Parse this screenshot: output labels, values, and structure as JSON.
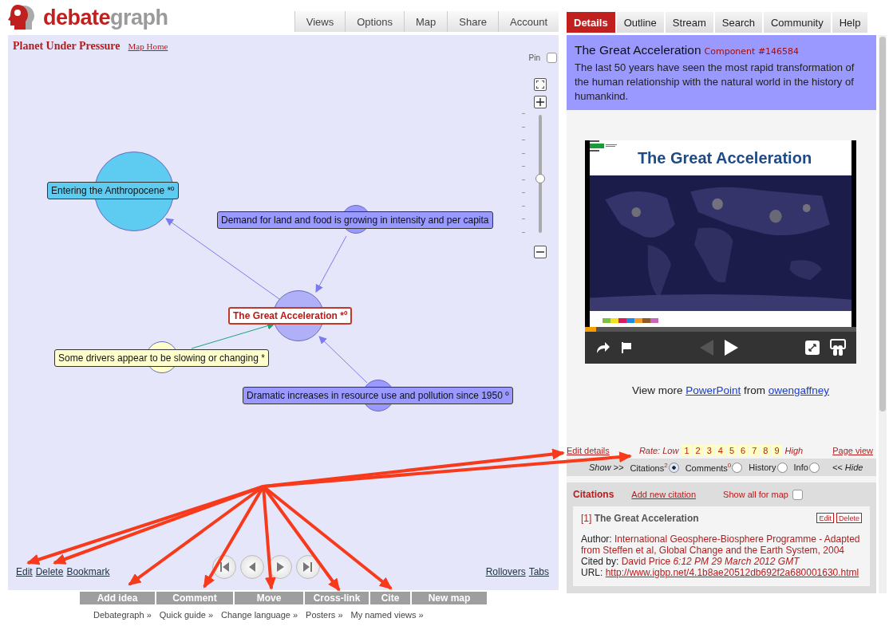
{
  "logo": {
    "parts": [
      "debate",
      "graph"
    ]
  },
  "top_menu": [
    "Views",
    "Options",
    "Map",
    "Share",
    "Account"
  ],
  "map": {
    "title": "Planet Under Pressure",
    "home_link": "Map Home",
    "pin": {
      "label": "Pin",
      "checked": false
    },
    "zoom": {
      "level": 0.45
    },
    "nodes": [
      {
        "label": "Entering the Anthropocene *º",
        "color": "#5ecbf0",
        "selected": false
      },
      {
        "label": "Demand for land and food is growing in intensity and per capita",
        "color": "#9999ff",
        "selected": false
      },
      {
        "label": "The Great Acceleration *º",
        "color": "#ffffff",
        "selected": true
      },
      {
        "label": "Some drivers appear to be slowing or changing *",
        "color": "#ffffcc",
        "selected": false
      },
      {
        "label": "Dramatic increases in resource use and pollution since 1950 º",
        "color": "#9999ff",
        "selected": false
      }
    ],
    "left_links": [
      "Edit",
      "Delete",
      "Bookmark"
    ],
    "right_links": [
      "Rollovers",
      "Tabs"
    ]
  },
  "actions": [
    "Add idea",
    "Comment",
    "Move",
    "Cross-link",
    "Cite",
    "New map"
  ],
  "footer_links": [
    "Debategraph »",
    "Quick guide »",
    "Change language »",
    "Posters »",
    "My named views »"
  ],
  "tabs": [
    {
      "label": "Details",
      "selected": true
    },
    {
      "label": "Outline",
      "selected": false
    },
    {
      "label": "Stream",
      "selected": false
    },
    {
      "label": "Search",
      "selected": false
    },
    {
      "label": "Community",
      "selected": false
    },
    {
      "label": "Help",
      "selected": false
    }
  ],
  "details": {
    "title": "The Great Acceleration",
    "component": "Component #146584",
    "text": "The last 50 years have seen the most rapid transformation of the human relationship with the natural world in the history of humankind."
  },
  "slide": {
    "title": "The Great Acceleration",
    "progress": {
      "level": 0.04
    },
    "caption": "View more",
    "link_1": "PowerPoint",
    "middle": "from",
    "link_2": "owengaffney"
  },
  "rating": {
    "edit_link": "Edit details",
    "label": "Rate: Low",
    "values": [
      "1",
      "2",
      "3",
      "4",
      "5",
      "6",
      "7",
      "8",
      "9"
    ],
    "high": "High",
    "page_link": "Page view"
  },
  "show": {
    "label": "Show >>",
    "options": [
      {
        "label": "Citations",
        "count": "2",
        "selected": true
      },
      {
        "label": "Comments",
        "count": "0",
        "selected": false
      },
      {
        "label": "History",
        "selected": false
      },
      {
        "label": "Info",
        "selected": false
      }
    ],
    "hide": "<< Hide"
  },
  "citations": {
    "title": "Citations",
    "add_link": "Add new citation",
    "show_all": {
      "label": "Show all for map",
      "checked": false
    },
    "items": [
      {
        "number": "[1]",
        "title": "The Great Acceleration",
        "buttons": [
          "Edit",
          "Delete"
        ],
        "author_label": "Author:",
        "author": "International Geosphere-Biosphere Programme - Adapted from Steffen et al, Global Change and the Earth System, 2004",
        "cited_label": "Cited by:",
        "cited_by": "David Price",
        "cited_date": "6:12 PM 29 March 2012 GMT",
        "url_label": "URL:",
        "url": "http://www.igbp.net/4.1b8ae20512db692f2a680001630.html"
      }
    ]
  }
}
